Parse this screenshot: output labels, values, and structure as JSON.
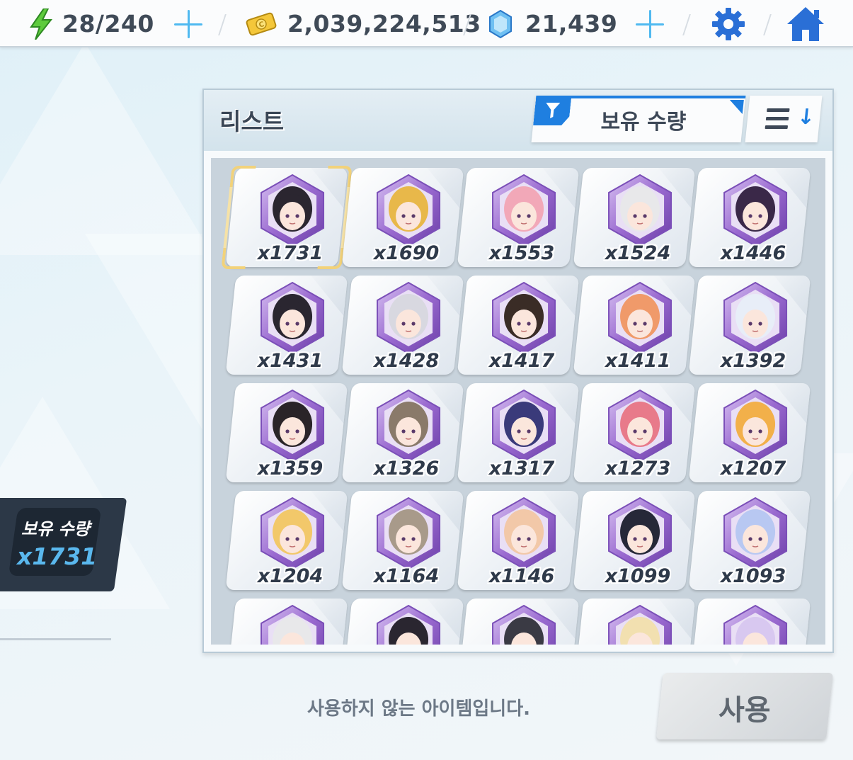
{
  "topbar": {
    "stamina": {
      "icon": "lightning-icon",
      "value": "28/240"
    },
    "gold": {
      "icon": "gold-coin-icon",
      "value": "2,039,224,513"
    },
    "gems": {
      "icon": "crystal-gem-icon",
      "value": "21,439"
    },
    "settings_icon": "gear-icon",
    "home_icon": "home-icon"
  },
  "list": {
    "title": "리스트",
    "filter": {
      "icon": "funnel-icon",
      "selected": "보유 수량"
    },
    "sort_icon": "sort-descending-icon",
    "items": [
      {
        "count": "x1731",
        "selected": true
      },
      {
        "count": "x1690"
      },
      {
        "count": "x1553"
      },
      {
        "count": "x1524"
      },
      {
        "count": "x1446"
      },
      {
        "count": "x1431"
      },
      {
        "count": "x1428"
      },
      {
        "count": "x1417"
      },
      {
        "count": "x1411"
      },
      {
        "count": "x1392"
      },
      {
        "count": "x1359"
      },
      {
        "count": "x1326"
      },
      {
        "count": "x1317"
      },
      {
        "count": "x1273"
      },
      {
        "count": "x1207"
      },
      {
        "count": "x1204"
      },
      {
        "count": "x1164"
      },
      {
        "count": "x1146"
      },
      {
        "count": "x1099"
      },
      {
        "count": "x1093"
      },
      {
        "count": ""
      },
      {
        "count": ""
      },
      {
        "count": ""
      },
      {
        "count": ""
      },
      {
        "count": ""
      }
    ]
  },
  "detail": {
    "held_label": "보유 수량",
    "held_value": "x1731",
    "desc_fragment": "."
  },
  "footer": {
    "unused_text": "사용하지 않는 아이템입니다.",
    "use_button": "사용"
  },
  "colors": {
    "accent_blue": "#1f7fe0",
    "plus_blue": "#4fb9f0",
    "selection_gold": "#f2d27a",
    "hex_purple": "#9a6ad0",
    "held_value_blue": "#5ab8ee"
  }
}
